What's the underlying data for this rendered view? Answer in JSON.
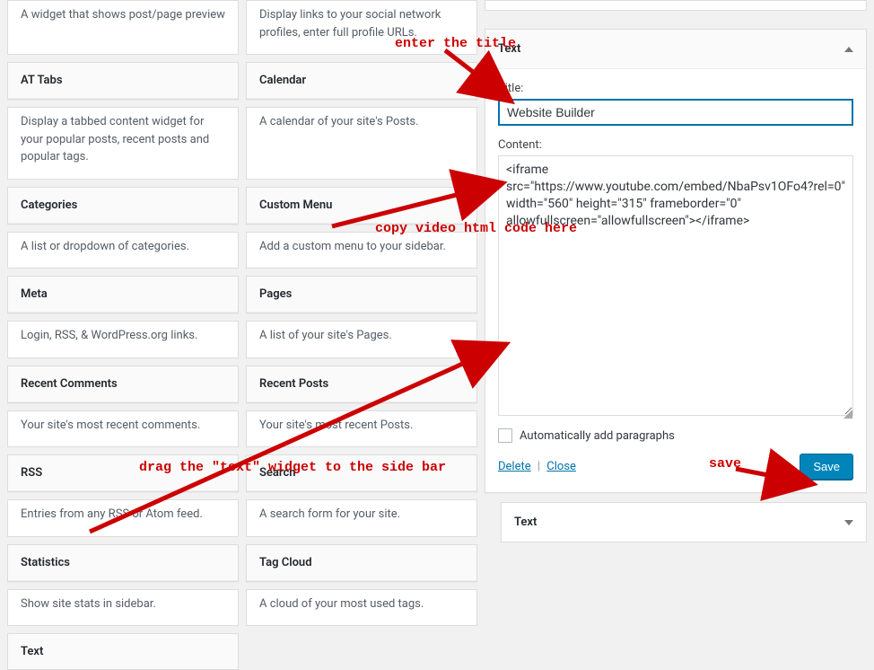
{
  "widgets": [
    {
      "name": "",
      "desc": "A widget that shows post/page preview"
    },
    {
      "name": "",
      "desc": "Display links to your social network profiles, enter full profile URLs."
    },
    {
      "name": "AT Tabs",
      "desc": "Display a tabbed content widget for your popular posts, recent posts and popular tags."
    },
    {
      "name": "Calendar",
      "desc": "A calendar of your site's Posts."
    },
    {
      "name": "Categories",
      "desc": "A list or dropdown of categories."
    },
    {
      "name": "Custom Menu",
      "desc": "Add a custom menu to your sidebar."
    },
    {
      "name": "Meta",
      "desc": "Login, RSS, & WordPress.org links."
    },
    {
      "name": "Pages",
      "desc": "A list of your site's Pages."
    },
    {
      "name": "Recent Comments",
      "desc": "Your site's most recent comments."
    },
    {
      "name": "Recent Posts",
      "desc": "Your site's most recent Posts."
    },
    {
      "name": "RSS",
      "desc": "Entries from any RSS or Atom feed."
    },
    {
      "name": "Search",
      "desc": "A search form for your site."
    },
    {
      "name": "Statistics",
      "desc": "Show site stats in sidebar."
    },
    {
      "name": "Tag Cloud",
      "desc": "A cloud of your most used tags."
    },
    {
      "name": "Text",
      "desc": ""
    }
  ],
  "open_widget": {
    "title_label": "Title:",
    "header_label": "Text",
    "title_value": "Website Builder",
    "content_label": "Content:",
    "content_value": "<iframe src=\"https://www.youtube.com/embed/NbaPsv1OFo4?rel=0\" width=\"560\" height=\"315\" frameborder=\"0\" allowfullscreen=\"allowfullscreen\"></iframe>",
    "checkbox_label": "Automatically add paragraphs",
    "delete_label": "Delete",
    "close_label": "Close",
    "save_label": "Save"
  },
  "collapsed_widget": {
    "label": "Text"
  },
  "annotations": {
    "a1": "enter the title",
    "a2": "copy video html code here",
    "a3": "drag the \"text\" widget to the side bar",
    "a4": "save"
  }
}
